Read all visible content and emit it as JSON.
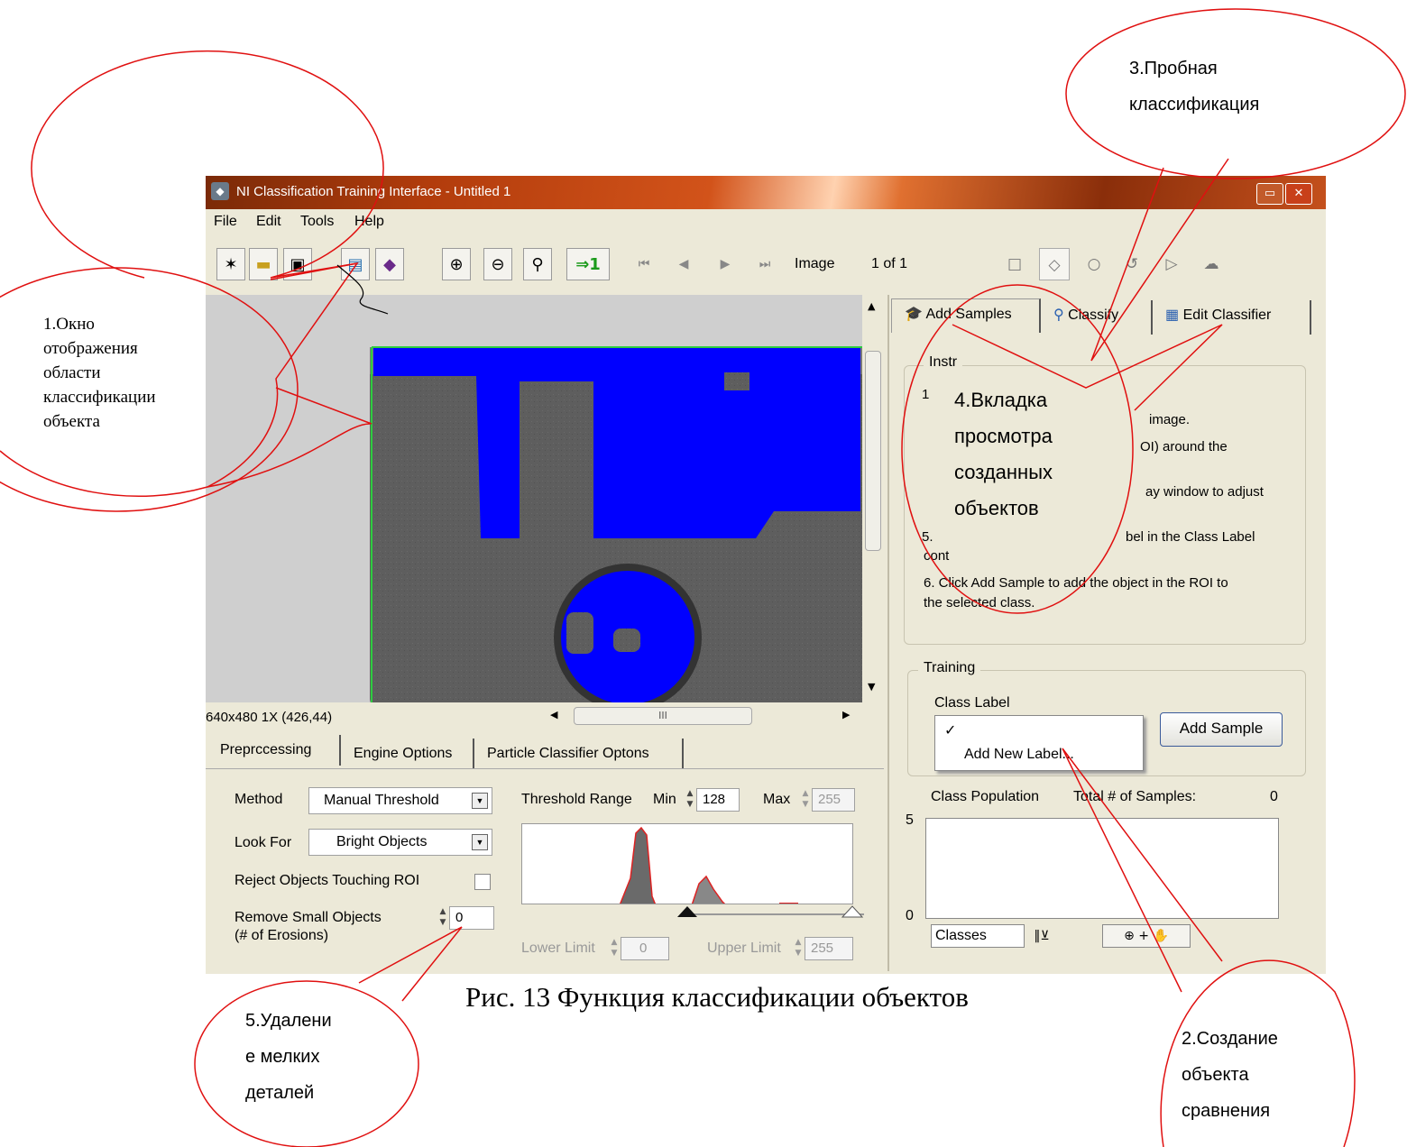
{
  "window": {
    "title": "NI Classification Training Interface - Untitled 1",
    "menu": [
      "File",
      "Edit",
      "Tools",
      "Help"
    ],
    "controls": {
      "restore": "▭",
      "close": "✕"
    }
  },
  "toolbar": {
    "goto_label": "⇒1",
    "image_label": "Image",
    "image_counter": "1  of  1",
    "nav": [
      "⏮",
      "◀",
      "▶",
      "⏭"
    ],
    "icons": [
      "new-icon",
      "open-icon",
      "save-icon",
      "open-image-icon",
      "book-icon",
      "zoom-in-icon",
      "zoom-out-icon",
      "zoom-1to1-icon",
      "goto-icon"
    ],
    "shapes": [
      "□",
      "◇",
      "○",
      "↺",
      "▷",
      "☁"
    ]
  },
  "display": {
    "status": "640x480 1X    (426,44)",
    "scroll_thumb": "III"
  },
  "bottom_tabs": [
    "Preprccessing",
    "Engine Options",
    "Particle Classifier Optons"
  ],
  "preprocessing": {
    "method_label": "Method",
    "method_value": "Manual Threshold",
    "lookfor_label": "Look For",
    "lookfor_value": "Bright Objects",
    "reject_label": "Reject Objects Touching ROI",
    "remove_label_1": "Remove Small Objects",
    "remove_label_2": "(# of Erosions)",
    "remove_value": "0",
    "threshold_label": "Threshold Range",
    "min_label": "Min",
    "min_value": "128",
    "max_label": "Max",
    "max_value": "255",
    "lower_label": "Lower Limit",
    "lower_value": "0",
    "upper_label": "Upper Limit",
    "upper_value": "255"
  },
  "right_tabs": [
    "Add Samples",
    "Classify",
    "Edit Classifier"
  ],
  "instructions": {
    "group_label": "Instr",
    "lines": [
      "1",
      "image.",
      "OI) around the",
      "ay window to adjust",
      "5.",
      "bel in the Class Label",
      "cont",
      "6. Click Add Sample to add the object in the ROI to",
      "the selected class."
    ]
  },
  "training": {
    "group_label": "Training",
    "class_label": "Class Label",
    "dropdown_items": [
      "✓",
      "Add New Label..."
    ],
    "add_sample": "Add Sample",
    "population_label": "Class Population",
    "total_label": "Total # of Samples:",
    "total_value": "0",
    "y_ticks": [
      "5",
      "0"
    ],
    "legend_label": "Classes"
  },
  "annotations": {
    "a1": [
      "1.Окно",
      "отображения",
      "области",
      "классификации",
      "объекта"
    ],
    "a2": [
      "2.Создание",
      "объекта",
      "сравнения"
    ],
    "a3": [
      "3.Пробная",
      "классификация"
    ],
    "a4": [
      "4.Вкладка",
      "просмотра",
      "созданных",
      "объектов"
    ],
    "a5": [
      "5.Удалени",
      "е мелких",
      "деталей"
    ]
  },
  "caption": "Рис. 13 Функция классификации объектов",
  "colors": {
    "annotation": "#e01010",
    "threshold_overlay": "#0000ff",
    "titlebar": "#b23c0c"
  }
}
